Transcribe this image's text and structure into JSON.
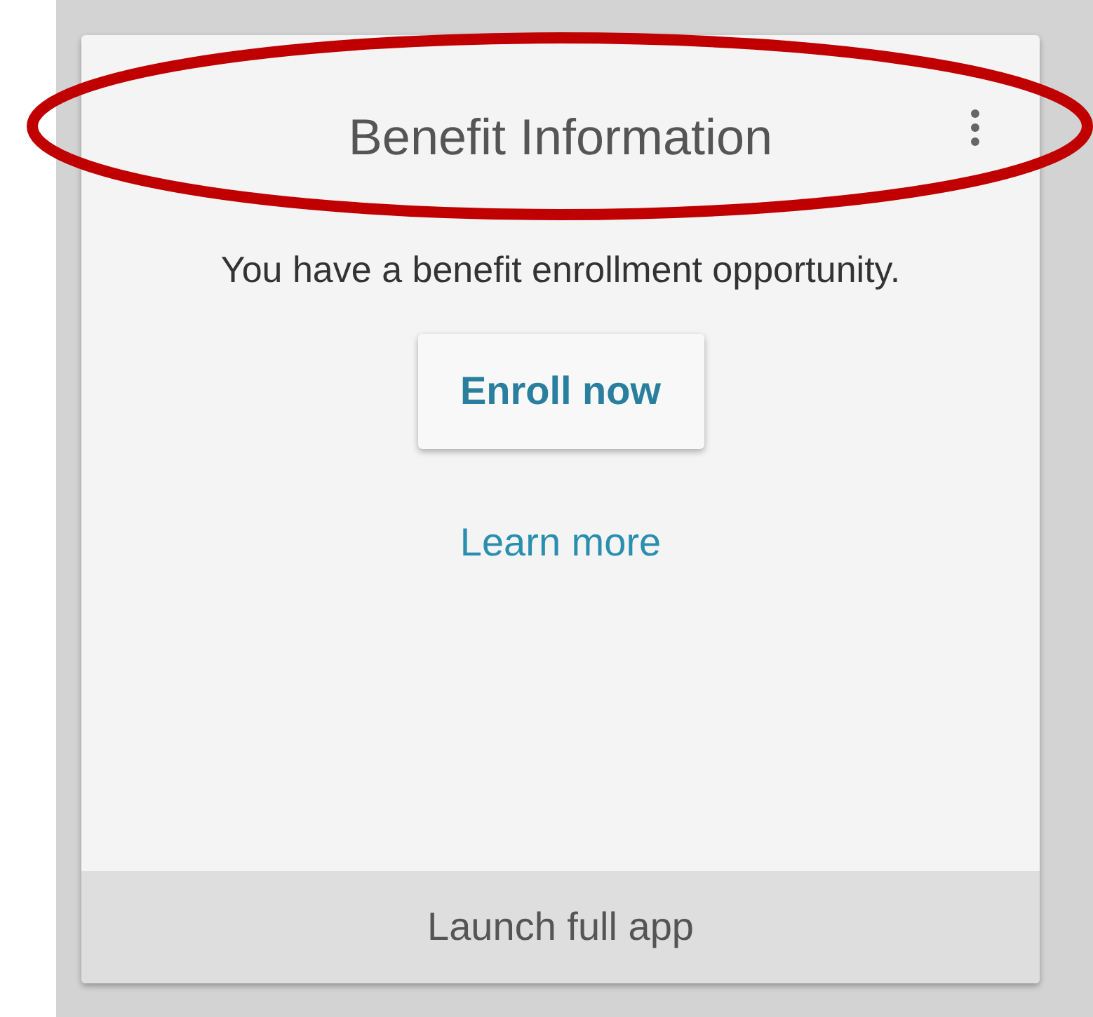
{
  "card": {
    "title": "Benefit Information",
    "message": "You have a benefit enrollment opportunity.",
    "primary_button": "Enroll now",
    "link": "Learn more",
    "footer_button": "Launch full app"
  }
}
